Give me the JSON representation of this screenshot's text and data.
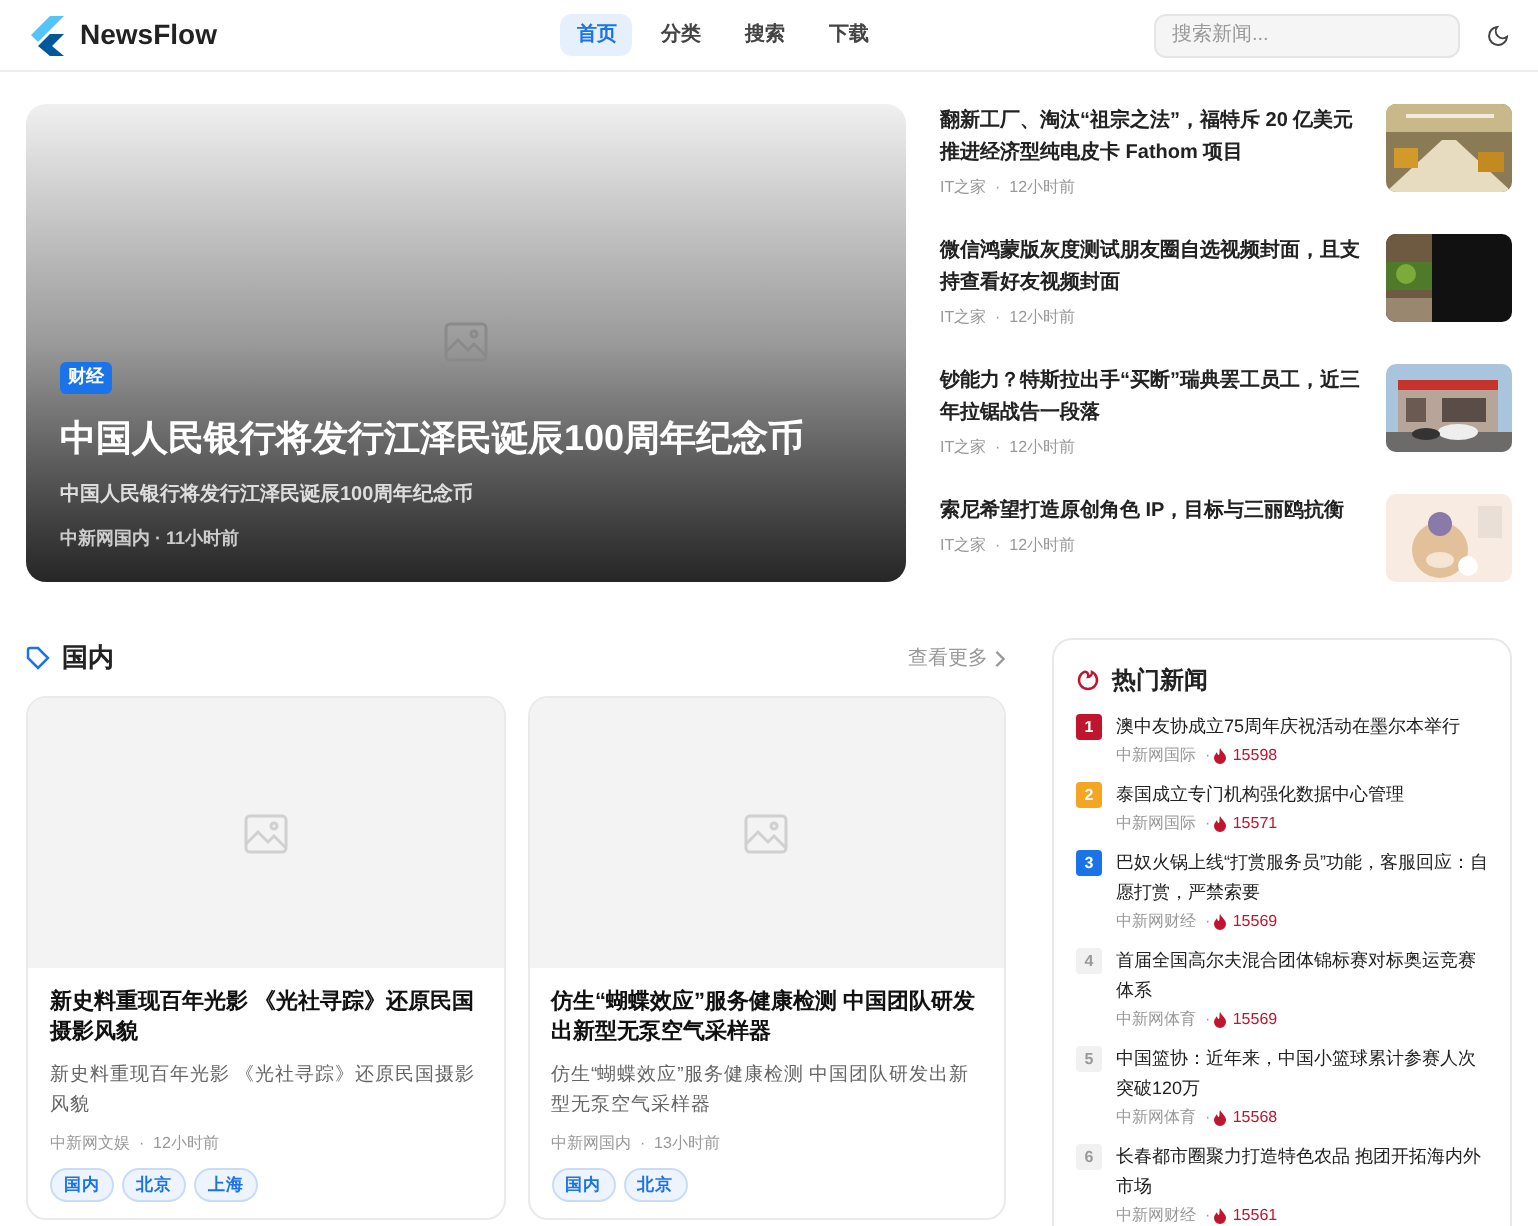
{
  "header": {
    "brand": "NewsFlow",
    "nav": [
      {
        "label": "首页",
        "selected": true
      },
      {
        "label": "分类",
        "selected": false
      },
      {
        "label": "搜索",
        "selected": false
      },
      {
        "label": "下载",
        "selected": false
      }
    ],
    "search": {
      "placeholder": "搜索新闻..."
    }
  },
  "hero": {
    "badge": "财经",
    "title": "中国人民银行将发行江泽民诞辰100周年纪念币",
    "summary": "中国人民银行将发行江泽民诞辰100周年纪念币",
    "source": "中新网国内",
    "sep": "·",
    "time": "11小时前"
  },
  "side_news": [
    {
      "title": "翻新工厂、淘汰“祖宗之法”，福特斥 20 亿美元推进经济型纯电皮卡 Fathom 项目",
      "source": "IT之家",
      "sep": "·",
      "time": "12小时前",
      "kind": "picture"
    },
    {
      "title": "微信鸿蒙版灰度测试朋友圈自选视频封面，且支持查看好友视频封面",
      "source": "IT之家",
      "sep": "·",
      "time": "12小时前",
      "kind": "picture"
    },
    {
      "title": "钞能力？特斯拉出手“买断”瑞典罢工员工，近三年拉锯战告一段落",
      "source": "IT之家",
      "sep": "·",
      "time": "12小时前",
      "kind": "picture"
    },
    {
      "title": "索尼希望打造原创角色 IP，目标与三丽鸥抗衡",
      "source": "IT之家",
      "sep": "·",
      "time": "12小时前",
      "kind": "picture"
    }
  ],
  "section": {
    "title": "国内",
    "more": "查看更多"
  },
  "cards": [
    {
      "title": "新史料重现百年光影 《光社寻踪》还原民国摄影风貌",
      "summary": "新史料重现百年光影 《光社寻踪》还原民国摄影风貌",
      "source": "中新网文娱",
      "sep": "·",
      "time": "12小时前",
      "tags": [
        "国内",
        "北京",
        "上海"
      ]
    },
    {
      "title": "仿生“蝴蝶效应”服务健康检测 中国团队研发出新型无泵空气采样器",
      "summary": "仿生“蝴蝶效应”服务健康检测 中国团队研发出新型无泵空气采样器",
      "source": "中新网国内",
      "sep": "·",
      "time": "13小时前",
      "tags": [
        "国内",
        "北京"
      ]
    }
  ],
  "hot": {
    "title": "热门新闻",
    "items": [
      {
        "rank": "1",
        "color": "#c0152f",
        "title": "澳中友协成立75周年庆祝活动在墨尔本举行",
        "source": "中新网国际",
        "sep": "·",
        "heat": "15598"
      },
      {
        "rank": "2",
        "color": "#f5a524",
        "title": "泰国成立专门机构强化数据中心管理",
        "source": "中新网国际",
        "sep": "·",
        "heat": "15571"
      },
      {
        "rank": "3",
        "color": "#1a73e8",
        "title": "巴奴火锅上线“打赏服务员”功能，客服回应：自愿打赏，严禁索要",
        "source": "中新网财经",
        "sep": "·",
        "heat": "15569"
      },
      {
        "rank": "4",
        "color": "#f1f1f1",
        "title": "首届全国高尔夫混合团体锦标赛对标奥运竞赛体系",
        "source": "中新网体育",
        "sep": "·",
        "heat": "15569"
      },
      {
        "rank": "5",
        "color": "#f1f1f1",
        "title": "中国篮协：近年来，中国小篮球累计参赛人次突破120万",
        "source": "中新网体育",
        "sep": "·",
        "heat": "15568"
      },
      {
        "rank": "6",
        "color": "#f1f1f1",
        "title": "长春都市圈聚力打造特色农品 抱团开拓海内外市场",
        "source": "中新网财经",
        "sep": "·",
        "heat": "15561"
      }
    ]
  }
}
